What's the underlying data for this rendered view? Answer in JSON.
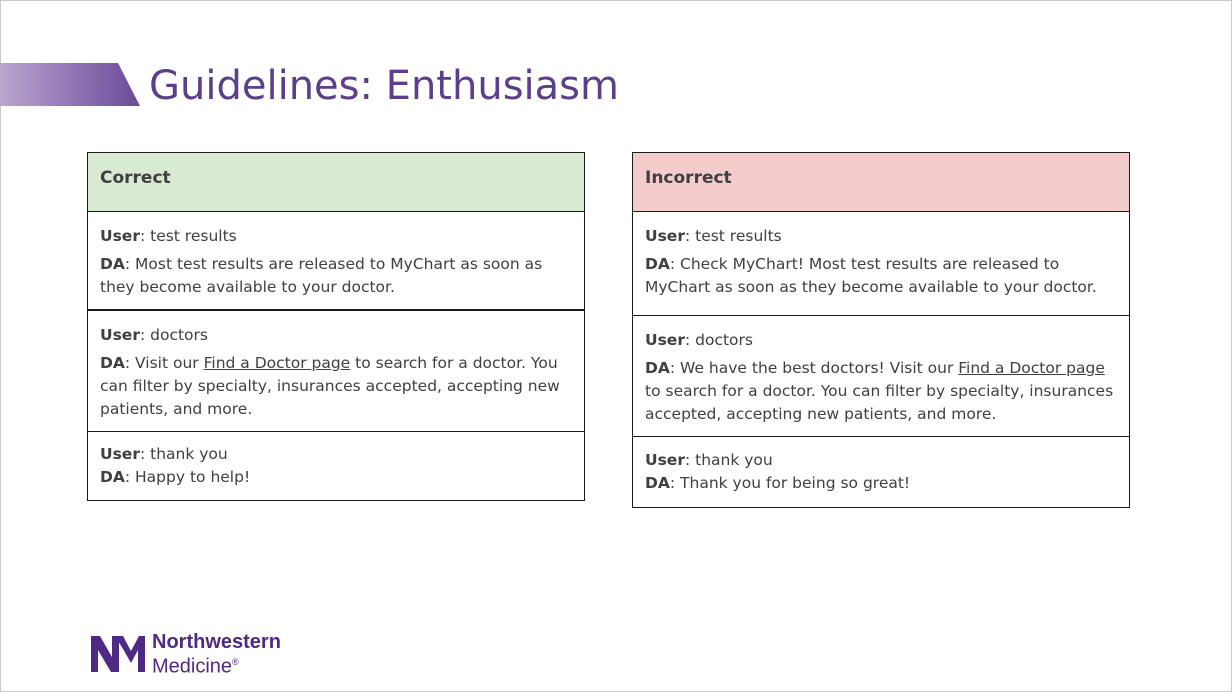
{
  "slide": {
    "title": "Guidelines: Enthusiasm"
  },
  "correct": {
    "header": "Correct",
    "exchanges": [
      {
        "user_label": "User",
        "user_text": ": test results",
        "da_label": "DA",
        "da_text": ": Most test results are released to MyChart as soon as they become available to your doctor."
      },
      {
        "user_label": "User",
        "user_text": ": doctors",
        "da_label": "DA",
        "da_text_before": ": Visit our ",
        "da_link": "Find a Doctor page",
        "da_text_after": " to search for a doctor. You can filter by specialty, insurances accepted, accepting new patients, and more."
      },
      {
        "user_label": "User",
        "user_text": ": thank you",
        "da_label": "DA",
        "da_text": ": Happy to help!"
      }
    ]
  },
  "incorrect": {
    "header": "Incorrect",
    "exchanges": [
      {
        "user_label": "User",
        "user_text": ": test results",
        "da_label": "DA",
        "da_text": ": Check MyChart! Most test results are released to MyChart as soon as they become available to your doctor."
      },
      {
        "user_label": "User",
        "user_text": ": doctors",
        "da_label": "DA",
        "da_text_before": ": We have the best doctors! Visit our ",
        "da_link": "Find a Doctor page",
        "da_text_after": " to search for a doctor. You can filter by specialty, insurances accepted, accepting new patients, and more."
      },
      {
        "user_label": "User",
        "user_text": ": thank you",
        "da_label": "DA",
        "da_text": ": Thank you for being so great!"
      }
    ]
  },
  "logo": {
    "line1": "Northwestern",
    "line2": "Medicine",
    "registered": "®",
    "color": "#4e2a84"
  },
  "colors": {
    "title": "#5b3f8c",
    "correct_header_bg": "#d9ead3",
    "incorrect_header_bg": "#f4cccc"
  }
}
